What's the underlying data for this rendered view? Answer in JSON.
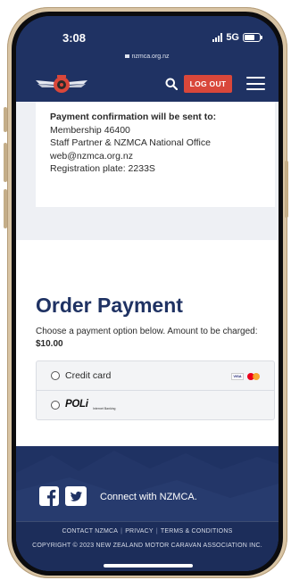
{
  "status_bar": {
    "time": "3:08",
    "network": "5G",
    "url": "nzmca.org.nz"
  },
  "nav": {
    "logout_label": "LOG OUT",
    "logo_icon": "nzmca-winged-wheel-logo",
    "search_icon": "search-icon",
    "menu_icon": "hamburger-menu-icon"
  },
  "confirmation": {
    "title": "Payment confirmation will be sent to:",
    "lines": [
      "Membership 46400",
      "Staff Partner & NZMCA National Office",
      "web@nzmca.org.nz",
      "Registration plate: 2233S"
    ]
  },
  "order": {
    "title": "Order Payment",
    "description": "Choose a payment option below. Amount to be charged:",
    "amount": "$10.00"
  },
  "payment_options": [
    {
      "label": "Credit card",
      "brands": [
        "VISA",
        "mastercard"
      ]
    },
    {
      "label": "POLi",
      "sublabel": "Internet Banking"
    }
  ],
  "footer": {
    "connect_text": "Connect with NZMCA.",
    "links": [
      "CONTACT NZMCA",
      "PRIVACY",
      "TERMS & CONDITIONS"
    ],
    "copyright": "COPYRIGHT © 2023 NEW ZEALAND MOTOR CARAVAN ASSOCIATION INC."
  },
  "colors": {
    "brand_navy": "#1f3263",
    "logout_red": "#d9473a",
    "page_bg": "#eef0f4"
  }
}
